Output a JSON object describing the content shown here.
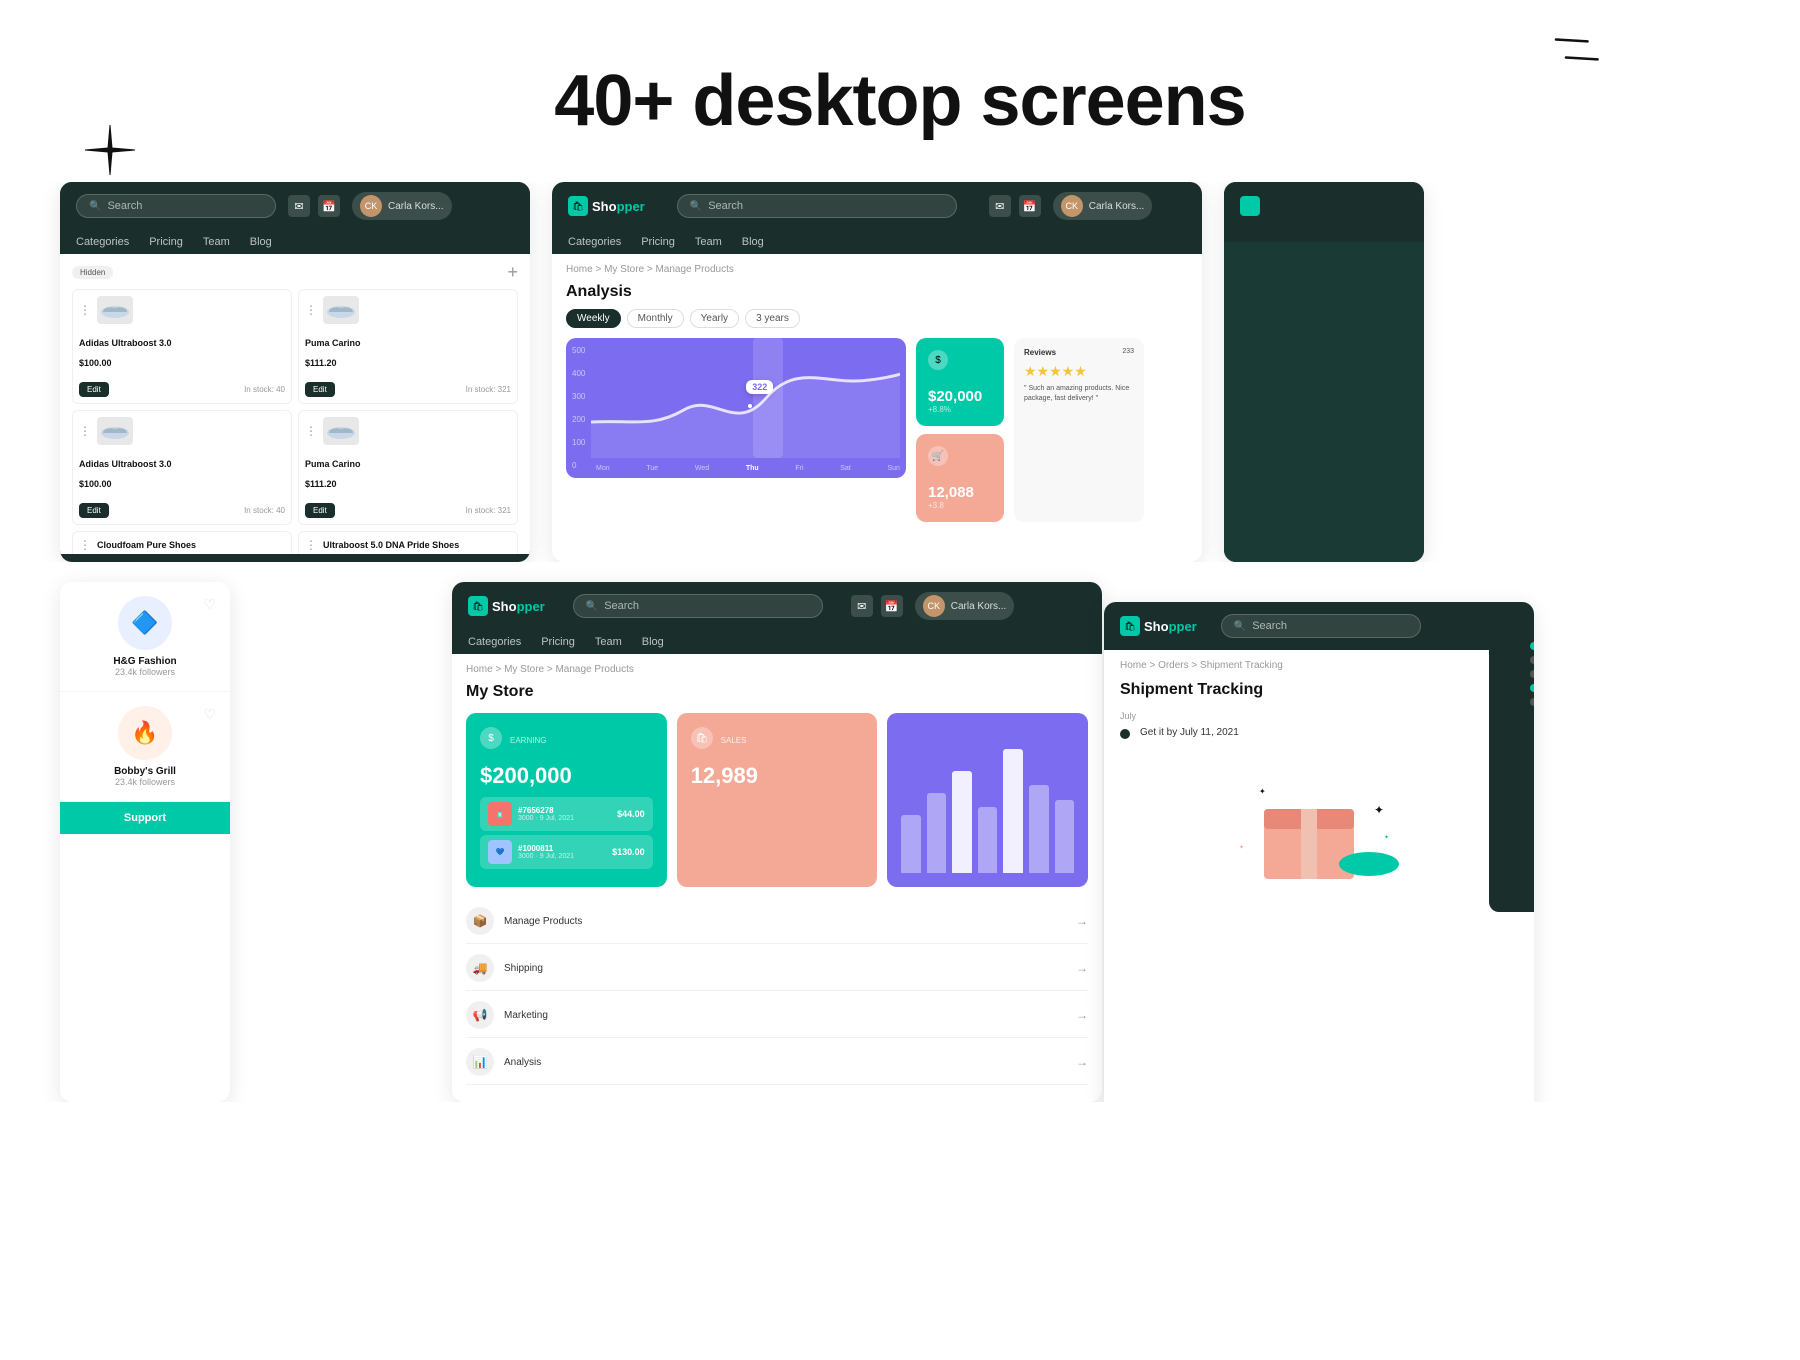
{
  "hero": {
    "title": "40+ desktop screens"
  },
  "brand": {
    "name": "Shopper",
    "name_part1": "Shop",
    "name_part2": "per"
  },
  "nav": {
    "search_placeholder": "Search",
    "user_name": "Carla Kors...",
    "links": [
      "Categories",
      "Pricing",
      "Team",
      "Blog"
    ]
  },
  "breadcrumb_analysis": "Home > My Store > Manage Products",
  "analysis": {
    "title": "Analysis",
    "tabs": [
      "Weekly",
      "Monthly",
      "Yearly",
      "3 years"
    ],
    "active_tab": "Weekly",
    "chart_days": [
      "Mon",
      "Tue",
      "Wed",
      "Thu",
      "Fri",
      "Sat",
      "Sun"
    ],
    "chart_values": [
      500,
      400,
      300,
      200,
      100,
      0
    ],
    "highlight_value": "322",
    "highlight_day": "Thu",
    "stats": [
      {
        "value": "$20,000",
        "sub": "+8.8%",
        "icon": "$",
        "color": "teal"
      },
      {
        "value": "12,088",
        "sub": "+3.8",
        "icon": "🛒",
        "color": "salmon"
      }
    ],
    "reviews": {
      "title": "Reviews",
      "count": "233",
      "text": "Such an amazing products. Nice package, fast delivery!"
    }
  },
  "products": [
    {
      "name": "Adidas Ultraboost 3.0",
      "price": "$100.00",
      "stock": "In stock: 40",
      "img": "👟"
    },
    {
      "name": "Puma Carino",
      "price": "$111.20",
      "stock": "In stock: 321",
      "img": "👟"
    },
    {
      "name": "Adidas Ultraboost 3.0",
      "price": "$100.00",
      "stock": "In stock: 40",
      "img": "👟"
    },
    {
      "name": "Puma Carino",
      "price": "$111.20",
      "stock": "In stock: 321",
      "img": "👟"
    },
    {
      "name": "Cloudfoam Pure Shoes",
      "price": "",
      "stock": "",
      "img": "👟"
    },
    {
      "name": "Ultraboost 5.0 DNA Pride Shoes",
      "price": "",
      "stock": "",
      "img": "👟"
    }
  ],
  "my_store": {
    "title": "My Store",
    "breadcrumb": "Home > My Store > Manage Products",
    "earning": {
      "label": "EARNING",
      "value": "$200,000",
      "icon": "$",
      "orders": [
        {
          "id": "#7656278",
          "date": "3000 · 9 Jul, 2021",
          "price": "$44.00",
          "color": "#f4736a"
        },
        {
          "id": "#1000811",
          "date": "3000 · 9 Jul, 2021",
          "price": "$130.00",
          "color": "#a0c4ff"
        }
      ]
    },
    "sales": {
      "label": "SALES",
      "value": "12,989",
      "icon": "🛍"
    },
    "links": [
      {
        "label": "Manage Products",
        "icon": "📦"
      },
      {
        "label": "Shipping",
        "icon": "🚚"
      },
      {
        "label": "Marketing",
        "icon": "📢"
      },
      {
        "label": "Analysis",
        "icon": "📊"
      }
    ]
  },
  "social": {
    "items": [
      {
        "name": "H&G Fashion",
        "followers": "23.4k followers",
        "icon": "🔷",
        "bg": "#e8f0ff"
      },
      {
        "name": "Bobby's Grill",
        "followers": "23.4k followers",
        "icon": "🔥",
        "bg": "#fff0e8"
      }
    ],
    "support_label": "Support"
  },
  "shipment": {
    "breadcrumb": "Home > Orders > Shipment Tracking",
    "title": "Shipment Tracking",
    "month": "July",
    "delivery_text": "Get it by July 11, 2021"
  },
  "pricing_label": "Pricing",
  "team_label": "Team"
}
